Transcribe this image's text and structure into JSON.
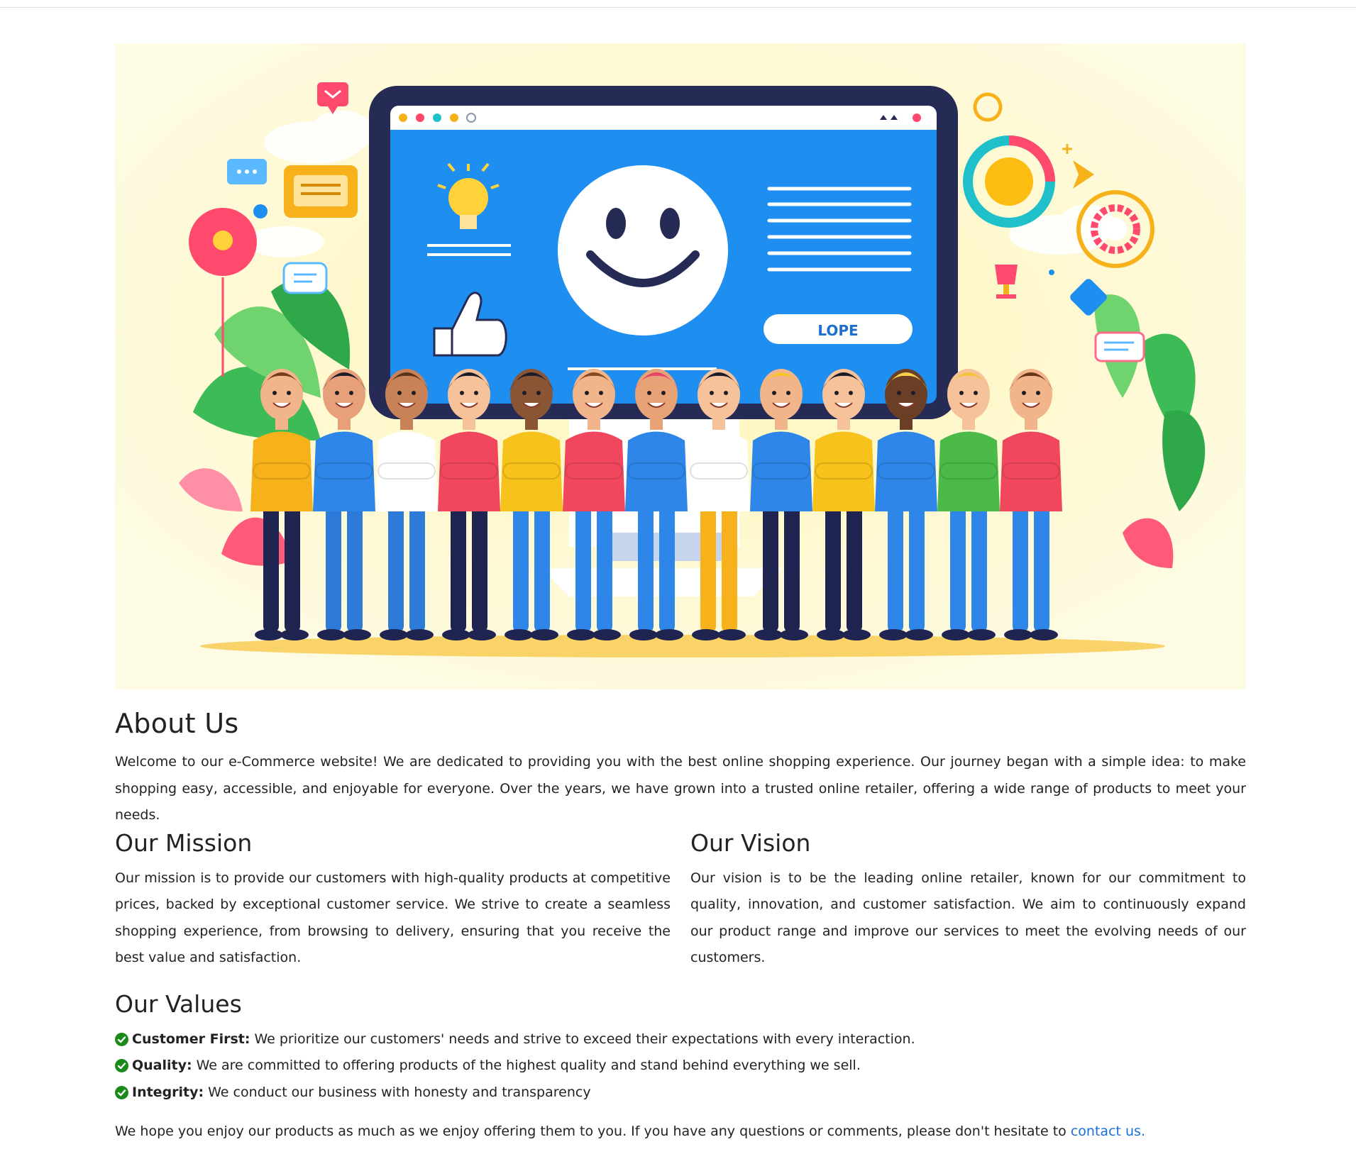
{
  "hero": {
    "screen_button_text": "LOPE"
  },
  "about": {
    "title": "About Us",
    "intro": "Welcome to our e-Commerce website! We are dedicated to providing you with the best online shopping experience. Our journey began with a simple idea: to make shopping easy, accessible, and enjoyable for everyone. Over the years, we have grown into a trusted online retailer, offering a wide range of products to meet your needs."
  },
  "mission": {
    "title": "Our Mission",
    "text": "Our mission is to provide our customers with high-quality products at competitive prices, backed by exceptional customer service. We strive to create a seamless shopping experience, from browsing to delivery, ensuring that you receive the best value and satisfaction."
  },
  "vision": {
    "title": "Our Vision",
    "text": "Our vision is to be the leading online retailer, known for our commitment to quality, innovation, and customer satisfaction. We aim to continuously expand our product range and improve our services to meet the evolving needs of our customers."
  },
  "values": {
    "title": "Our Values",
    "items": [
      {
        "label": "Customer First:",
        "text": "We prioritize our customers' needs and strive to exceed their expectations with every interaction.",
        "icon": "check-circle-icon"
      },
      {
        "label": "Quality:",
        "text": "We are committed to offering products of the highest quality and stand behind everything we sell.",
        "icon": "check-circle-icon"
      },
      {
        "label": "Integrity:",
        "text": "We conduct our business with honesty and transparency",
        "icon": "check-circle-icon"
      }
    ]
  },
  "closing": {
    "text": "We hope you enjoy our products as much as we enjoy offering them to you. If you have any questions or comments, please don't hesitate to ",
    "link_text": "contact us."
  },
  "colors": {
    "link": "#1a6fd6",
    "check": "#1a8a1a",
    "hero_bg": "#fdfbe3",
    "screen_blue": "#1f8ef1",
    "monitor_frame": "#262b55"
  }
}
